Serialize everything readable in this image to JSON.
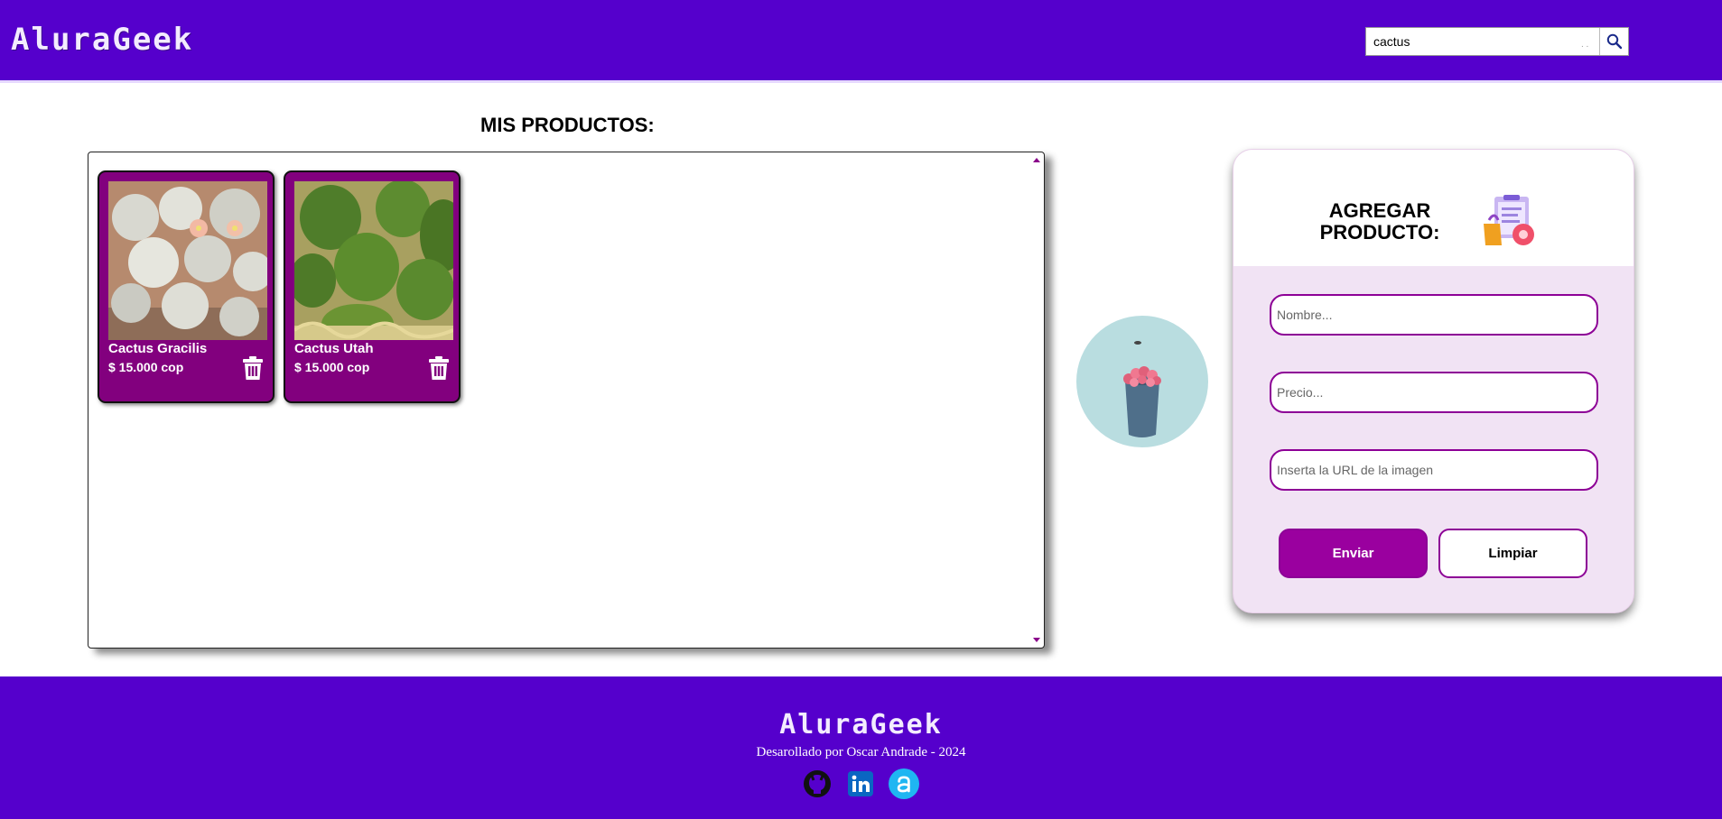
{
  "header": {
    "logo": "AluraGeek",
    "search": {
      "value": "cactus",
      "placeholder": "",
      "icon": "search-icon"
    }
  },
  "products": {
    "title": "MIS PRODUCTOS:",
    "items": [
      {
        "name": "Cactus Gracilis",
        "price": "$ 15.000 cop",
        "delete_icon": "trash-icon"
      },
      {
        "name": "Cactus Utah",
        "price": "$ 15.000 cop",
        "delete_icon": "trash-icon"
      }
    ]
  },
  "form": {
    "title": "AGREGAR PRODUCTO:",
    "fields": {
      "name_placeholder": "Nombre...",
      "price_placeholder": "Precio...",
      "url_placeholder": "Inserta la URL de la imagen"
    },
    "send_label": "Enviar",
    "clear_label": "Limpiar"
  },
  "footer": {
    "logo": "AluraGeek",
    "credit": "Desarollado por Oscar Andrade - 2024",
    "socials": [
      "github-icon",
      "linkedin-icon",
      "alura-icon"
    ]
  },
  "colors": {
    "header_bg": "#5500cc",
    "card_bg": "#82007e",
    "accent": "#9a009f",
    "form_bg": "#f1e3f4"
  }
}
